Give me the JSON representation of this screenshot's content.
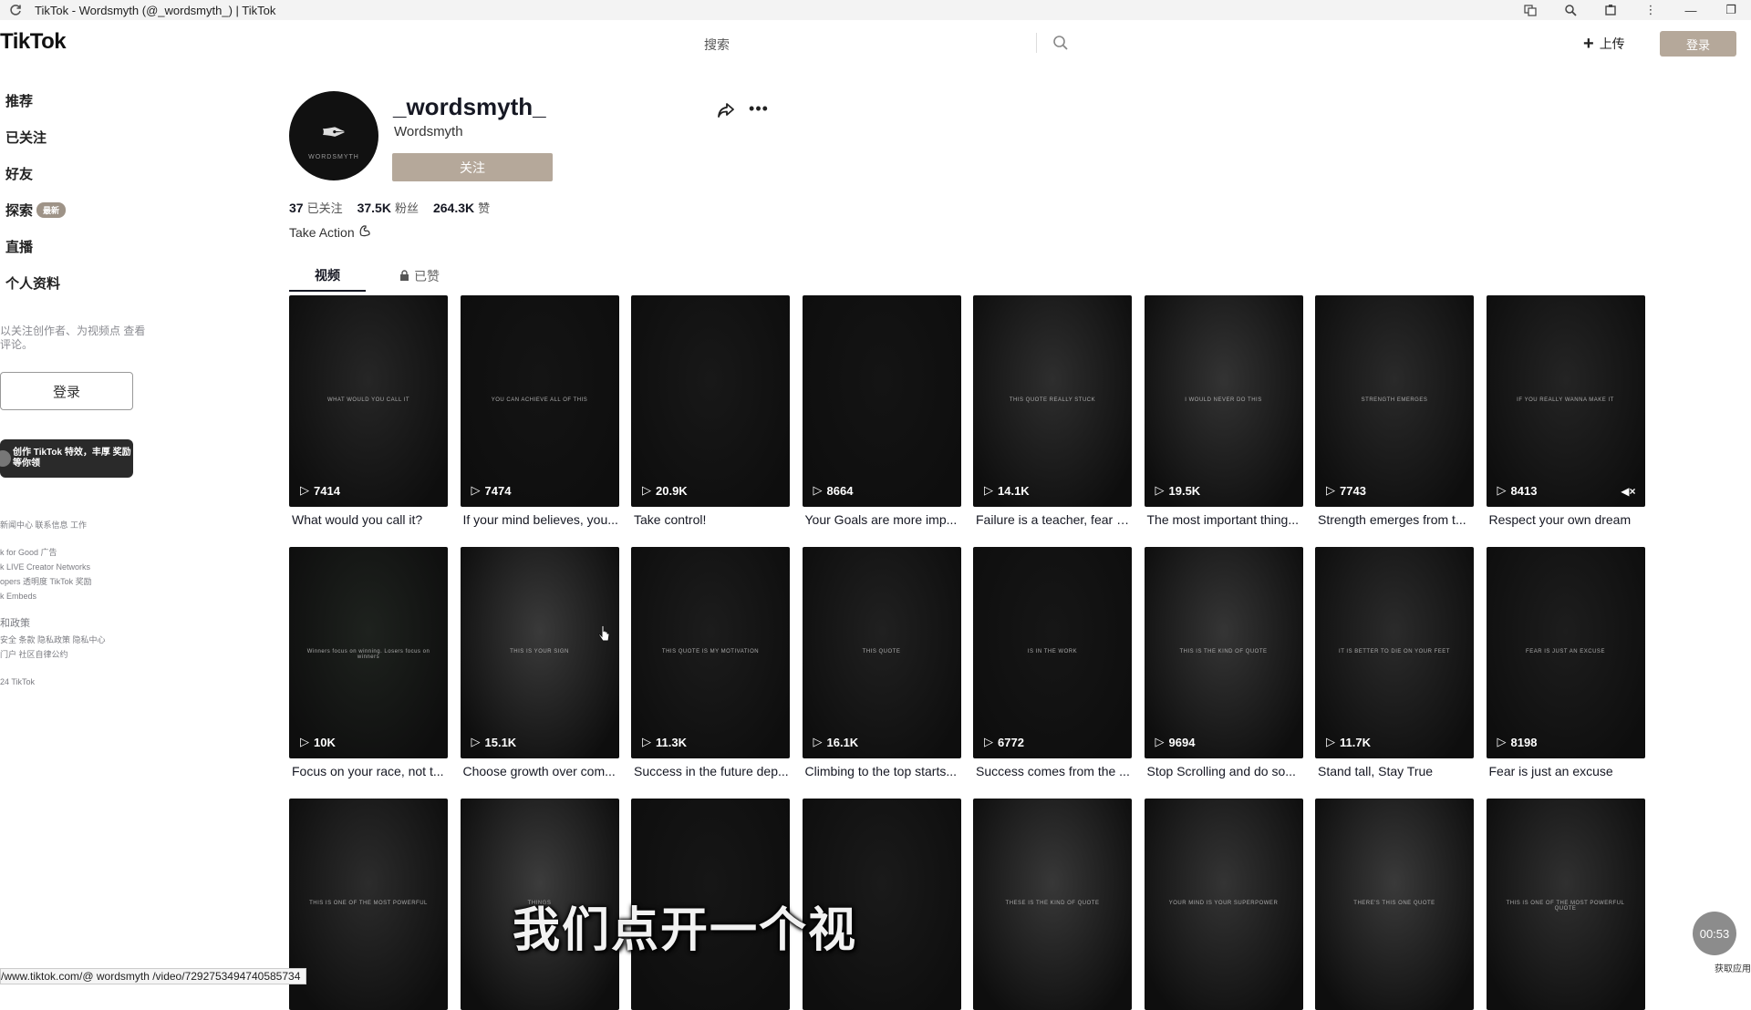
{
  "window": {
    "title": "TikTok - Wordsmyth (@_wordsmyth_) | TikTok",
    "controls": [
      "—",
      "❐"
    ]
  },
  "header": {
    "logo": "TikTok",
    "search_placeholder": "搜索",
    "upload_label": "上传",
    "login_label": "登录"
  },
  "sidebar": {
    "items": [
      {
        "label": "推荐"
      },
      {
        "label": "已关注"
      },
      {
        "label": "好友"
      },
      {
        "label": "探索",
        "badge": "最新"
      },
      {
        "label": "直播"
      },
      {
        "label": "个人资料"
      }
    ],
    "hint": "以关注创作者、为视频点 查看评论。",
    "login_label": "登录",
    "effects_card": "创作 TikTok 特效，丰厚 奖励等你领",
    "footer": [
      "新闻中心  联系信息  工作",
      "k for Good  广告",
      "k LIVE Creator Networks",
      "opers  透明度  TikTok 奖励",
      "k Embeds",
      "和政策",
      "安全  条款  隐私政策  隐私中心",
      "门户  社区自律公约",
      "24 TikTok"
    ]
  },
  "profile": {
    "unique_id": "_wordsmyth_",
    "nickname": "Wordsmyth",
    "follow_label": "关注",
    "avatar_text": "WORDSMYTH",
    "following_count": "37",
    "following_label": "已关注",
    "followers_count": "37.5K",
    "followers_label": "粉丝",
    "likes_count": "264.3K",
    "likes_label": "赞",
    "bio": "Take Action",
    "share_icon": "share-icon",
    "more_icon": "more-icon"
  },
  "tabs": {
    "videos": "视频",
    "liked": "已赞"
  },
  "videos": [
    {
      "views": "7414",
      "caption": "What would you call it?",
      "overlay": "WHAT WOULD YOU CALL IT",
      "bg": "#262626"
    },
    {
      "views": "7474",
      "caption": "If your mind believes, you...",
      "overlay": "YOU CAN ACHIEVE ALL OF THIS",
      "bg": "#141414"
    },
    {
      "views": "20.9K",
      "caption": "Take control!",
      "overlay": "",
      "bg": "#181818"
    },
    {
      "views": "8664",
      "caption": "Your Goals are more imp...",
      "overlay": "",
      "bg": "#141414"
    },
    {
      "views": "14.1K",
      "caption": "Failure is a teacher, fear o...",
      "overlay": "THIS QUOTE REALLY STUCK",
      "bg": "#2e2e2e"
    },
    {
      "views": "19.5K",
      "caption": "The most important thing...",
      "overlay": "I WOULD NEVER DO THIS",
      "bg": "#333333"
    },
    {
      "views": "7743",
      "caption": "Strength emerges from t...",
      "overlay": "STRENGTH EMERGES",
      "bg": "#2a2a2a"
    },
    {
      "views": "8413",
      "caption": "Respect your own dream",
      "overlay": "IF YOU REALLY WANNA MAKE IT",
      "bg": "#242424",
      "muted": true
    },
    {
      "views": "10K",
      "caption": "Focus on your race, not t...",
      "overlay": "Winners focus on winning. Losers focus on winners",
      "bg": "#1e221e"
    },
    {
      "views": "15.1K",
      "caption": "Choose growth over com...",
      "overlay": "THIS IS YOUR SIGN",
      "bg": "#3a3a3a"
    },
    {
      "views": "11.3K",
      "caption": "Success in the future dep...",
      "overlay": "THIS QUOTE IS MY MOTIVATION",
      "bg": "#1c1c1c"
    },
    {
      "views": "16.1K",
      "caption": "Climbing to the top starts...",
      "overlay": "THIS QUOTE",
      "bg": "#202020"
    },
    {
      "views": "6772",
      "caption": "Success comes from the ...",
      "overlay": "IS IN THE WORK",
      "bg": "#161616"
    },
    {
      "views": "9694",
      "caption": "Stop Scrolling and do so...",
      "overlay": "THIS IS THE KIND OF QUOTE",
      "bg": "#353535"
    },
    {
      "views": "11.7K",
      "caption": "Stand tall, Stay True",
      "overlay": "IT IS BETTER TO DIE ON YOUR FEET",
      "bg": "#2b2b2b"
    },
    {
      "views": "8198",
      "caption": "Fear is just an excuse",
      "overlay": "FEAR IS JUST AN EXCUSE",
      "bg": "#1d1d1d"
    },
    {
      "views": "",
      "caption": "",
      "overlay": "THIS IS ONE OF THE MOST POWERFUL",
      "bg": "#2c2c2c"
    },
    {
      "views": "",
      "caption": "",
      "overlay": "THINGS",
      "bg": "#3c3c3c"
    },
    {
      "views": "",
      "caption": "",
      "overlay": "",
      "bg": "#161616"
    },
    {
      "views": "",
      "caption": "",
      "overlay": "",
      "bg": "#1a1a1a"
    },
    {
      "views": "",
      "caption": "",
      "overlay": "THESE IS THE KIND OF QUOTE",
      "bg": "#383838"
    },
    {
      "views": "",
      "caption": "",
      "overlay": "YOUR MIND IS YOUR SUPERPOWER",
      "bg": "#343434"
    },
    {
      "views": "",
      "caption": "",
      "overlay": "THERE'S THIS ONE QUOTE",
      "bg": "#3a3a3a"
    },
    {
      "views": "",
      "caption": "",
      "overlay": "THIS IS ONE OF THE MOST POWERFUL QUOTE",
      "bg": "#303030"
    }
  ],
  "overlay": {
    "subtitle": "我们点开一个视",
    "status_url": "/www.tiktok.com/@ wordsmyth /video/7292753494740585734",
    "timer": "00:53",
    "get_app": "获取应用"
  }
}
